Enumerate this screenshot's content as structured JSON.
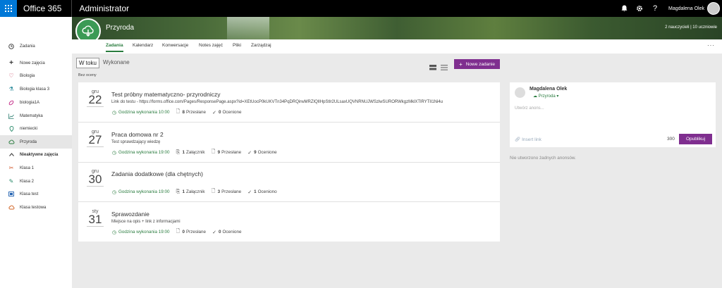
{
  "topbar": {
    "app_name": "Office 365",
    "section": "Administrator",
    "user_name": "Magdalena Olek",
    "icons": [
      "bell-icon",
      "gear-icon",
      "help-icon"
    ]
  },
  "sidebar": {
    "items": [
      {
        "label": "Zadania",
        "icon": "assignments-icon"
      },
      {
        "label": "Nowe zajęcia",
        "icon": "plus-icon"
      },
      {
        "label": "Biologia",
        "icon": "heart-icon"
      },
      {
        "label": "Biologia klasa 3",
        "icon": "flask-icon"
      },
      {
        "label": "biologia1A",
        "icon": "tag-icon"
      },
      {
        "label": "Matematyka",
        "icon": "chart-icon"
      },
      {
        "label": "niemiecki",
        "icon": "pin-icon"
      },
      {
        "label": "Przyroda",
        "icon": "cloud-icon"
      },
      {
        "label": "Nieaktywne zajęcia",
        "icon": "chevron-up-icon"
      },
      {
        "label": "Klasa 1",
        "icon": "tools-icon"
      },
      {
        "label": "Klasa 2",
        "icon": "pencil-icon"
      },
      {
        "label": "Klasa test",
        "icon": "screen-icon"
      },
      {
        "label": "Klasa testowa",
        "icon": "cloud-icon"
      }
    ]
  },
  "banner": {
    "class_name": "Przyroda",
    "stats": "2 nauczycieli | 10 uczniowie"
  },
  "nav": {
    "tabs": [
      "Zadania",
      "Kalendarz",
      "Konwersacje",
      "Notes zajęć",
      "Pliki",
      "Zarządzaj"
    ],
    "more": "···"
  },
  "toolbar": {
    "tab_active": "W toku",
    "tab_other": "Wykonane",
    "filter": "Bez oceny",
    "new_button": "Nowe zadanie",
    "new_button_icon": "+"
  },
  "assignments": [
    {
      "month": "gru",
      "day": "22",
      "title": "Test próbny matematyczno- przyrodniczy",
      "description": "Link do testu - https://forms.office.com/Pages/ResponsePage.aspx?id=XEtUocP0kUKVTn34PqDRQirwMRZIQlIHpStlr2ULsaxUQVNRNUJWSzlwSURORWkgzMklXTlRYTlI1Ni4u",
      "due": "Godzina wykonania 10:00",
      "attachments_count": "",
      "attachments_label": "",
      "submitted_count": "8",
      "submitted_label": "Przesłane",
      "graded_count": "0",
      "graded_label": "Ocenione"
    },
    {
      "month": "gru",
      "day": "27",
      "title": "Praca domowa nr 2",
      "description": "Test sprawdzający wiedzę",
      "due": "Godzina wykonania 19:00",
      "attachments_count": "1",
      "attachments_label": "Załącznik",
      "submitted_count": "9",
      "submitted_label": "Przesłane",
      "graded_count": "9",
      "graded_label": "Ocenione"
    },
    {
      "month": "gru",
      "day": "30",
      "title": "Zadania dodatkowe (dla chętnych)",
      "description": "",
      "due": "Godzina wykonania 19:00",
      "attachments_count": "1",
      "attachments_label": "Załącznik",
      "submitted_count": "3",
      "submitted_label": "Przesłane",
      "graded_count": "1",
      "graded_label": "Oceniono"
    },
    {
      "month": "sty",
      "day": "31",
      "title": "Sprawozdanie",
      "description": "Miejsce na opis + link z informacjami",
      "due": "Godzina wykonania 19:00",
      "attachments_count": "",
      "attachments_label": "",
      "submitted_count": "0",
      "submitted_label": "Przesłane",
      "graded_count": "0",
      "graded_label": "Ocenione"
    }
  ],
  "post": {
    "author": "Magdalena Olek",
    "class_name": "Przyroda",
    "placeholder": "Utwórz anons...",
    "insert_link": "Insert link",
    "char_count": "300",
    "publish": "Opublikuj",
    "empty_message": "Nie utworzono żadnych anonsów."
  },
  "colors": {
    "brand_blue": "#0078d7",
    "accent_purple": "#7f2e8f",
    "class_green": "#2a7c3f"
  }
}
